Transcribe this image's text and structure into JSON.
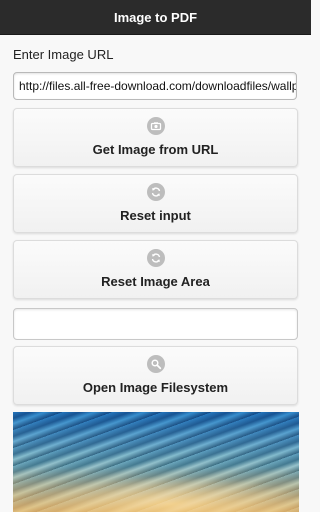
{
  "header": {
    "title": "Image to PDF"
  },
  "form": {
    "url_label": "Enter Image URL",
    "url_value": "http://files.all-free-download.com/downloadfiles/wallpapers"
  },
  "buttons": {
    "get_image": "Get Image from URL",
    "reset_input": "Reset input",
    "reset_image_area": "Reset Image Area",
    "open_filesystem": "Open Image Filesystem"
  },
  "icons": {
    "get_image": "camera-icon",
    "reset_input": "refresh-icon",
    "reset_image_area": "refresh-icon",
    "open_filesystem": "search-icon"
  },
  "colors": {
    "header_bg": "#2b2b2b",
    "icon_bg": "#bdbdbd"
  }
}
